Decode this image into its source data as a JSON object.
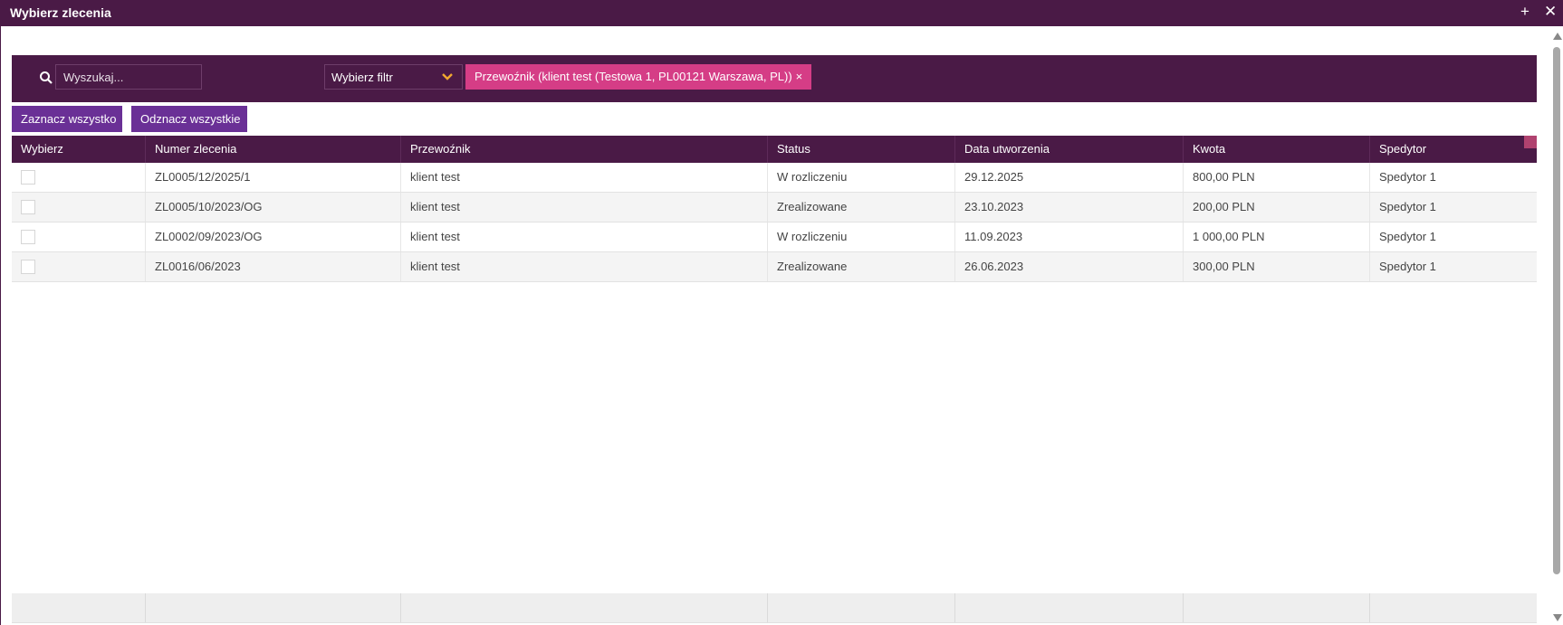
{
  "window": {
    "title": "Wybierz zlecenia",
    "add_icon": "plus-icon",
    "close_icon": "close-icon"
  },
  "toolbar": {
    "search_placeholder": "Wyszukaj...",
    "filter_label": "Wybierz filtr",
    "active_filter": "Przewoźnik (klient test (Testowa 1, PL00121 Warszawa, PL))",
    "active_filter_remove": "×"
  },
  "actions": {
    "select_all": "Zaznacz wszystko",
    "unselect_all": "Odznacz wszystkie"
  },
  "grid": {
    "columns": [
      "Wybierz",
      "Numer zlecenia",
      "Przewoźnik",
      "Status",
      "Data utworzenia",
      "Kwota",
      "Spedytor"
    ],
    "rows": [
      {
        "checked": false,
        "number": "ZL0005/12/2025/1",
        "carrier": "klient test",
        "status": "W rozliczeniu",
        "created": "29.12.2025",
        "amount": "800,00 PLN",
        "forwarder": "Spedytor 1"
      },
      {
        "checked": false,
        "number": "ZL0005/10/2023/OG",
        "carrier": "klient test",
        "status": "Zrealizowane",
        "created": "23.10.2023",
        "amount": "200,00 PLN",
        "forwarder": "Spedytor 1"
      },
      {
        "checked": false,
        "number": "ZL0002/09/2023/OG",
        "carrier": "klient test",
        "status": "W rozliczeniu",
        "created": "11.09.2023",
        "amount": "1 000,00 PLN",
        "forwarder": "Spedytor 1"
      },
      {
        "checked": false,
        "number": "ZL0016/06/2023",
        "carrier": "klient test",
        "status": "Zrealizowane",
        "created": "26.06.2023",
        "amount": "300,00 PLN",
        "forwarder": "Spedytor 1"
      }
    ]
  },
  "colors": {
    "header": "#4a1a46",
    "button": "#6a3096",
    "chip": "#d53d86"
  }
}
